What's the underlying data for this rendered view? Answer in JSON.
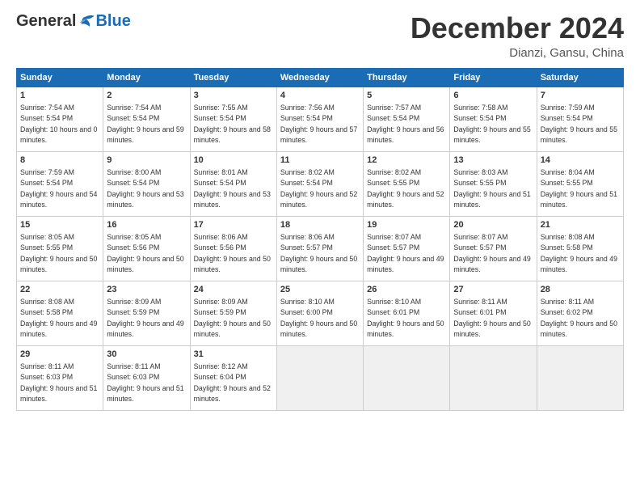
{
  "header": {
    "logo_general": "General",
    "logo_blue": "Blue",
    "title": "December 2024",
    "subtitle": "Dianzi, Gansu, China"
  },
  "calendar": {
    "days_of_week": [
      "Sunday",
      "Monday",
      "Tuesday",
      "Wednesday",
      "Thursday",
      "Friday",
      "Saturday"
    ],
    "weeks": [
      [
        {
          "day": 1,
          "sunrise": "7:54 AM",
          "sunset": "5:54 PM",
          "daylight": "10 hours and 0 minutes."
        },
        {
          "day": 2,
          "sunrise": "7:54 AM",
          "sunset": "5:54 PM",
          "daylight": "9 hours and 59 minutes."
        },
        {
          "day": 3,
          "sunrise": "7:55 AM",
          "sunset": "5:54 PM",
          "daylight": "9 hours and 58 minutes."
        },
        {
          "day": 4,
          "sunrise": "7:56 AM",
          "sunset": "5:54 PM",
          "daylight": "9 hours and 57 minutes."
        },
        {
          "day": 5,
          "sunrise": "7:57 AM",
          "sunset": "5:54 PM",
          "daylight": "9 hours and 56 minutes."
        },
        {
          "day": 6,
          "sunrise": "7:58 AM",
          "sunset": "5:54 PM",
          "daylight": "9 hours and 55 minutes."
        },
        {
          "day": 7,
          "sunrise": "7:59 AM",
          "sunset": "5:54 PM",
          "daylight": "9 hours and 55 minutes."
        }
      ],
      [
        {
          "day": 8,
          "sunrise": "7:59 AM",
          "sunset": "5:54 PM",
          "daylight": "9 hours and 54 minutes."
        },
        {
          "day": 9,
          "sunrise": "8:00 AM",
          "sunset": "5:54 PM",
          "daylight": "9 hours and 53 minutes."
        },
        {
          "day": 10,
          "sunrise": "8:01 AM",
          "sunset": "5:54 PM",
          "daylight": "9 hours and 53 minutes."
        },
        {
          "day": 11,
          "sunrise": "8:02 AM",
          "sunset": "5:54 PM",
          "daylight": "9 hours and 52 minutes."
        },
        {
          "day": 12,
          "sunrise": "8:02 AM",
          "sunset": "5:55 PM",
          "daylight": "9 hours and 52 minutes."
        },
        {
          "day": 13,
          "sunrise": "8:03 AM",
          "sunset": "5:55 PM",
          "daylight": "9 hours and 51 minutes."
        },
        {
          "day": 14,
          "sunrise": "8:04 AM",
          "sunset": "5:55 PM",
          "daylight": "9 hours and 51 minutes."
        }
      ],
      [
        {
          "day": 15,
          "sunrise": "8:05 AM",
          "sunset": "5:55 PM",
          "daylight": "9 hours and 50 minutes."
        },
        {
          "day": 16,
          "sunrise": "8:05 AM",
          "sunset": "5:56 PM",
          "daylight": "9 hours and 50 minutes."
        },
        {
          "day": 17,
          "sunrise": "8:06 AM",
          "sunset": "5:56 PM",
          "daylight": "9 hours and 50 minutes."
        },
        {
          "day": 18,
          "sunrise": "8:06 AM",
          "sunset": "5:57 PM",
          "daylight": "9 hours and 50 minutes."
        },
        {
          "day": 19,
          "sunrise": "8:07 AM",
          "sunset": "5:57 PM",
          "daylight": "9 hours and 49 minutes."
        },
        {
          "day": 20,
          "sunrise": "8:07 AM",
          "sunset": "5:57 PM",
          "daylight": "9 hours and 49 minutes."
        },
        {
          "day": 21,
          "sunrise": "8:08 AM",
          "sunset": "5:58 PM",
          "daylight": "9 hours and 49 minutes."
        }
      ],
      [
        {
          "day": 22,
          "sunrise": "8:08 AM",
          "sunset": "5:58 PM",
          "daylight": "9 hours and 49 minutes."
        },
        {
          "day": 23,
          "sunrise": "8:09 AM",
          "sunset": "5:59 PM",
          "daylight": "9 hours and 49 minutes."
        },
        {
          "day": 24,
          "sunrise": "8:09 AM",
          "sunset": "5:59 PM",
          "daylight": "9 hours and 50 minutes."
        },
        {
          "day": 25,
          "sunrise": "8:10 AM",
          "sunset": "6:00 PM",
          "daylight": "9 hours and 50 minutes."
        },
        {
          "day": 26,
          "sunrise": "8:10 AM",
          "sunset": "6:01 PM",
          "daylight": "9 hours and 50 minutes."
        },
        {
          "day": 27,
          "sunrise": "8:11 AM",
          "sunset": "6:01 PM",
          "daylight": "9 hours and 50 minutes."
        },
        {
          "day": 28,
          "sunrise": "8:11 AM",
          "sunset": "6:02 PM",
          "daylight": "9 hours and 50 minutes."
        }
      ],
      [
        {
          "day": 29,
          "sunrise": "8:11 AM",
          "sunset": "6:03 PM",
          "daylight": "9 hours and 51 minutes."
        },
        {
          "day": 30,
          "sunrise": "8:11 AM",
          "sunset": "6:03 PM",
          "daylight": "9 hours and 51 minutes."
        },
        {
          "day": 31,
          "sunrise": "8:12 AM",
          "sunset": "6:04 PM",
          "daylight": "9 hours and 52 minutes."
        },
        null,
        null,
        null,
        null
      ]
    ]
  }
}
